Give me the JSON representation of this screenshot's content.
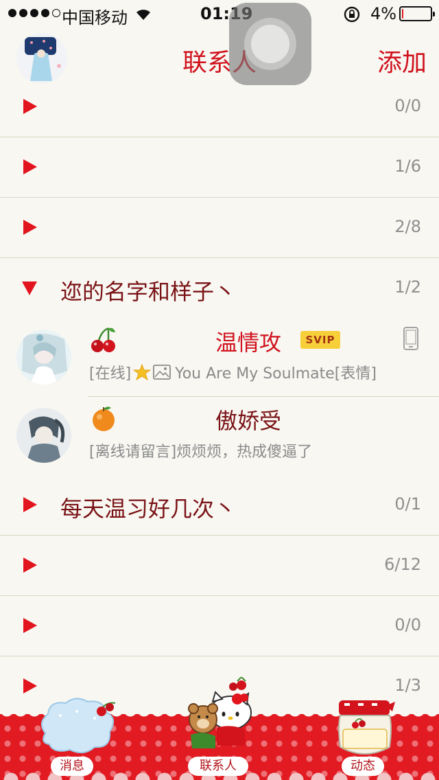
{
  "status_bar": {
    "carrier": "中国移动",
    "time": "01:19",
    "battery_percent": "4%",
    "battery_level": 0.04,
    "icons": [
      "signal-dots-icon",
      "wifi-icon",
      "rotation-lock-icon",
      "battery-icon"
    ]
  },
  "header": {
    "title": "联系人",
    "add_label": "添加"
  },
  "groups_top": [
    {
      "name": "",
      "count": "0/0"
    },
    {
      "name": "",
      "count": "1/6"
    },
    {
      "name": "",
      "count": "2/8"
    }
  ],
  "expanded_group": {
    "name": "迩的名字和样子丶",
    "count": "1/2",
    "contacts": [
      {
        "name": "温情攻",
        "emoji": "cherry-emoji-icon",
        "badge": "SVIP",
        "status_prefix": "[在线]",
        "status_text": "You Are My Soulmate[表情]",
        "device": "phone-icon"
      },
      {
        "name": "傲娇受",
        "emoji": "orange-emoji-icon",
        "status_text": "[离线请留言]烦烦烦，热成傻逼了"
      }
    ]
  },
  "groups_bottom": [
    {
      "name": "每天温习好几次丶",
      "count": "0/1"
    },
    {
      "name": "",
      "count": "6/12"
    },
    {
      "name": "",
      "count": "0/0"
    },
    {
      "name": "",
      "count": "1/3"
    }
  ],
  "tab_bar": {
    "tabs": [
      {
        "label": "消息",
        "icon": "sweet-cloud-icon"
      },
      {
        "label": "联系人",
        "icon": "hello-kitty-icon"
      },
      {
        "label": "动态",
        "icon": "cherry-jar-icon"
      }
    ]
  },
  "colors": {
    "accent_red": "#d1121d",
    "group_name": "#7a1316",
    "tab_bar_red": "#e21a22",
    "background": "#f8f7f2",
    "svip_yellow": "#f7cf3a"
  }
}
